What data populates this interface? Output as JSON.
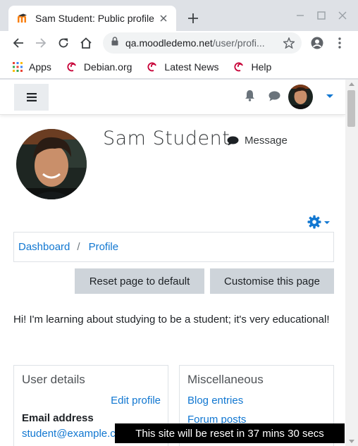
{
  "browser": {
    "tab_title": "Sam Student: Public profile",
    "url_host": "qa.moodledemo.net",
    "url_path": "/user/profi...",
    "bookmarks": [
      {
        "label": "Apps",
        "icon": "apps-grid-icon"
      },
      {
        "label": "Debian.org",
        "icon": "debian-swirl-icon"
      },
      {
        "label": "Latest News",
        "icon": "debian-swirl-icon"
      },
      {
        "label": "Help",
        "icon": "debian-swirl-icon"
      }
    ]
  },
  "colors": {
    "link": "#1177d1",
    "button_bg": "#ced4da",
    "toast_bg": "#000000"
  },
  "profile": {
    "name": "Sam Student",
    "message_label": "Message"
  },
  "breadcrumb": {
    "items": [
      "Dashboard",
      "Profile"
    ],
    "separator": "/"
  },
  "buttons": {
    "reset": "Reset page to default",
    "customise": "Customise this page"
  },
  "intro_text": "Hi! I'm learning about studying to be a student; it's very educational!",
  "user_details": {
    "title": "User details",
    "edit_link": "Edit profile",
    "email_label": "Email address",
    "email_value": "student@example.com"
  },
  "miscellaneous": {
    "title": "Miscellaneous",
    "links": [
      "Blog entries",
      "Forum posts"
    ]
  },
  "toast": "This site will be reset in 37 mins 30 secs"
}
